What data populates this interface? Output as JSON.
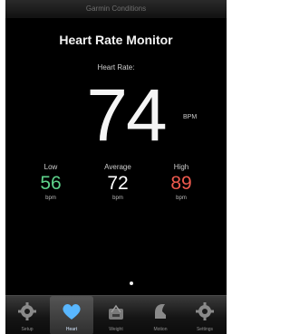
{
  "status_bar": {
    "text": "Garmin Conditions"
  },
  "screen": {
    "title": "Heart Rate Monitor",
    "heart_rate_label": "Heart Rate:",
    "current_value": "74",
    "current_unit": "BPM"
  },
  "stats": {
    "low": {
      "label": "Low",
      "value": "56",
      "unit": "bpm",
      "color": "#5ed38b"
    },
    "average": {
      "label": "Average",
      "value": "72",
      "unit": "bpm",
      "color": "#ffffff"
    },
    "high": {
      "label": "High",
      "value": "89",
      "unit": "bpm",
      "color": "#f05a4e"
    }
  },
  "tabs": [
    {
      "label": "Setup",
      "icon": "gear-icon",
      "active": false
    },
    {
      "label": "Heart",
      "icon": "heart-icon",
      "active": true
    },
    {
      "label": "Weight",
      "icon": "scale-icon",
      "active": false
    },
    {
      "label": "Motion",
      "icon": "shoe-icon",
      "active": false
    },
    {
      "label": "Settings",
      "icon": "gear-icon",
      "active": false
    }
  ],
  "colors": {
    "background": "#000000",
    "text_primary": "#f5f5f5",
    "active_tab_icon": "#59b7ff"
  }
}
